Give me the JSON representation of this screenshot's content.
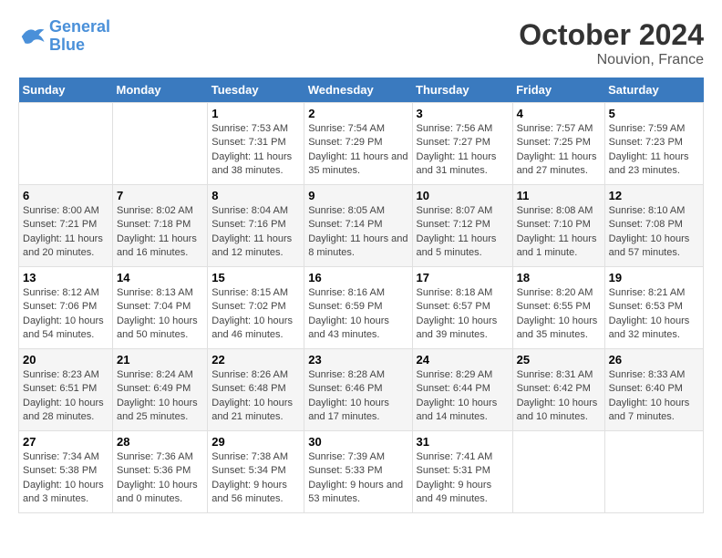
{
  "header": {
    "logo_general": "General",
    "logo_blue": "Blue",
    "month": "October 2024",
    "location": "Nouvion, France"
  },
  "days_of_week": [
    "Sunday",
    "Monday",
    "Tuesday",
    "Wednesday",
    "Thursday",
    "Friday",
    "Saturday"
  ],
  "weeks": [
    [
      {
        "day": "",
        "info": ""
      },
      {
        "day": "",
        "info": ""
      },
      {
        "day": "1",
        "info": "Sunrise: 7:53 AM\nSunset: 7:31 PM\nDaylight: 11 hours and 38 minutes."
      },
      {
        "day": "2",
        "info": "Sunrise: 7:54 AM\nSunset: 7:29 PM\nDaylight: 11 hours and 35 minutes."
      },
      {
        "day": "3",
        "info": "Sunrise: 7:56 AM\nSunset: 7:27 PM\nDaylight: 11 hours and 31 minutes."
      },
      {
        "day": "4",
        "info": "Sunrise: 7:57 AM\nSunset: 7:25 PM\nDaylight: 11 hours and 27 minutes."
      },
      {
        "day": "5",
        "info": "Sunrise: 7:59 AM\nSunset: 7:23 PM\nDaylight: 11 hours and 23 minutes."
      }
    ],
    [
      {
        "day": "6",
        "info": "Sunrise: 8:00 AM\nSunset: 7:21 PM\nDaylight: 11 hours and 20 minutes."
      },
      {
        "day": "7",
        "info": "Sunrise: 8:02 AM\nSunset: 7:18 PM\nDaylight: 11 hours and 16 minutes."
      },
      {
        "day": "8",
        "info": "Sunrise: 8:04 AM\nSunset: 7:16 PM\nDaylight: 11 hours and 12 minutes."
      },
      {
        "day": "9",
        "info": "Sunrise: 8:05 AM\nSunset: 7:14 PM\nDaylight: 11 hours and 8 minutes."
      },
      {
        "day": "10",
        "info": "Sunrise: 8:07 AM\nSunset: 7:12 PM\nDaylight: 11 hours and 5 minutes."
      },
      {
        "day": "11",
        "info": "Sunrise: 8:08 AM\nSunset: 7:10 PM\nDaylight: 11 hours and 1 minute."
      },
      {
        "day": "12",
        "info": "Sunrise: 8:10 AM\nSunset: 7:08 PM\nDaylight: 10 hours and 57 minutes."
      }
    ],
    [
      {
        "day": "13",
        "info": "Sunrise: 8:12 AM\nSunset: 7:06 PM\nDaylight: 10 hours and 54 minutes."
      },
      {
        "day": "14",
        "info": "Sunrise: 8:13 AM\nSunset: 7:04 PM\nDaylight: 10 hours and 50 minutes."
      },
      {
        "day": "15",
        "info": "Sunrise: 8:15 AM\nSunset: 7:02 PM\nDaylight: 10 hours and 46 minutes."
      },
      {
        "day": "16",
        "info": "Sunrise: 8:16 AM\nSunset: 6:59 PM\nDaylight: 10 hours and 43 minutes."
      },
      {
        "day": "17",
        "info": "Sunrise: 8:18 AM\nSunset: 6:57 PM\nDaylight: 10 hours and 39 minutes."
      },
      {
        "day": "18",
        "info": "Sunrise: 8:20 AM\nSunset: 6:55 PM\nDaylight: 10 hours and 35 minutes."
      },
      {
        "day": "19",
        "info": "Sunrise: 8:21 AM\nSunset: 6:53 PM\nDaylight: 10 hours and 32 minutes."
      }
    ],
    [
      {
        "day": "20",
        "info": "Sunrise: 8:23 AM\nSunset: 6:51 PM\nDaylight: 10 hours and 28 minutes."
      },
      {
        "day": "21",
        "info": "Sunrise: 8:24 AM\nSunset: 6:49 PM\nDaylight: 10 hours and 25 minutes."
      },
      {
        "day": "22",
        "info": "Sunrise: 8:26 AM\nSunset: 6:48 PM\nDaylight: 10 hours and 21 minutes."
      },
      {
        "day": "23",
        "info": "Sunrise: 8:28 AM\nSunset: 6:46 PM\nDaylight: 10 hours and 17 minutes."
      },
      {
        "day": "24",
        "info": "Sunrise: 8:29 AM\nSunset: 6:44 PM\nDaylight: 10 hours and 14 minutes."
      },
      {
        "day": "25",
        "info": "Sunrise: 8:31 AM\nSunset: 6:42 PM\nDaylight: 10 hours and 10 minutes."
      },
      {
        "day": "26",
        "info": "Sunrise: 8:33 AM\nSunset: 6:40 PM\nDaylight: 10 hours and 7 minutes."
      }
    ],
    [
      {
        "day": "27",
        "info": "Sunrise: 7:34 AM\nSunset: 5:38 PM\nDaylight: 10 hours and 3 minutes."
      },
      {
        "day": "28",
        "info": "Sunrise: 7:36 AM\nSunset: 5:36 PM\nDaylight: 10 hours and 0 minutes."
      },
      {
        "day": "29",
        "info": "Sunrise: 7:38 AM\nSunset: 5:34 PM\nDaylight: 9 hours and 56 minutes."
      },
      {
        "day": "30",
        "info": "Sunrise: 7:39 AM\nSunset: 5:33 PM\nDaylight: 9 hours and 53 minutes."
      },
      {
        "day": "31",
        "info": "Sunrise: 7:41 AM\nSunset: 5:31 PM\nDaylight: 9 hours and 49 minutes."
      },
      {
        "day": "",
        "info": ""
      },
      {
        "day": "",
        "info": ""
      }
    ]
  ]
}
